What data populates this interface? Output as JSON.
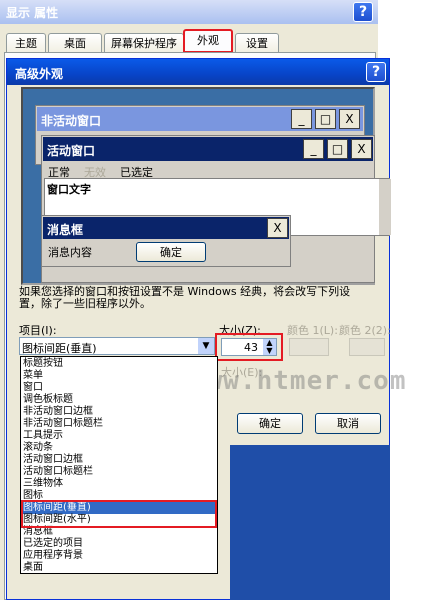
{
  "outer_window": {
    "title": "显示 属性",
    "help_icon": "?",
    "tabs": [
      "主题",
      "桌面",
      "屏幕保护程序",
      "外观",
      "设置"
    ],
    "active_tab": "外观"
  },
  "dialog": {
    "title": "高级外观",
    "help_icon": "?",
    "preview": {
      "inactive_window_title": "非活动窗口",
      "active_window_title": "活动窗口",
      "menu_items": [
        "正常",
        "无效",
        "已选定"
      ],
      "window_text": "窗口文字",
      "message_box_title": "消息框",
      "message_text": "消息内容",
      "ok_label": "确定",
      "minimize_glyph": "_",
      "maximize_glyph": "□",
      "close_glyph": "X"
    },
    "info_text_line1": "如果您选择的窗口和按钮设置不是 Windows 经典，将会改写下列设",
    "info_text_line2": "置，除了一些旧程序以外。",
    "item_label": "项目(I):",
    "item_value": "图标间距(垂直)",
    "size_label": "大小(Z):",
    "size_value": "43",
    "color1_label": "颜色 1(L):",
    "color2_label": "颜色 2(2):",
    "font_size_label": "大小(E):",
    "ok_button": "确定",
    "cancel_button": "取消",
    "dropdown_items": [
      "标题按钮",
      "菜单",
      "窗口",
      "调色板标题",
      "非活动窗口边框",
      "非活动窗口标题栏",
      "工具提示",
      "滚动条",
      "活动窗口边框",
      "活动窗口标题栏",
      "三维物体",
      "图标",
      "图标间距(垂直)",
      "图标间距(水平)",
      "消息框",
      "已选定的项目",
      "应用程序背景",
      "桌面"
    ],
    "selected_item_index": 12
  },
  "watermark": "www.htmer.com",
  "colors": {
    "title_blue": "#0a5ae8",
    "highlight": "#316ac5",
    "annotation_red": "#e41b23"
  }
}
